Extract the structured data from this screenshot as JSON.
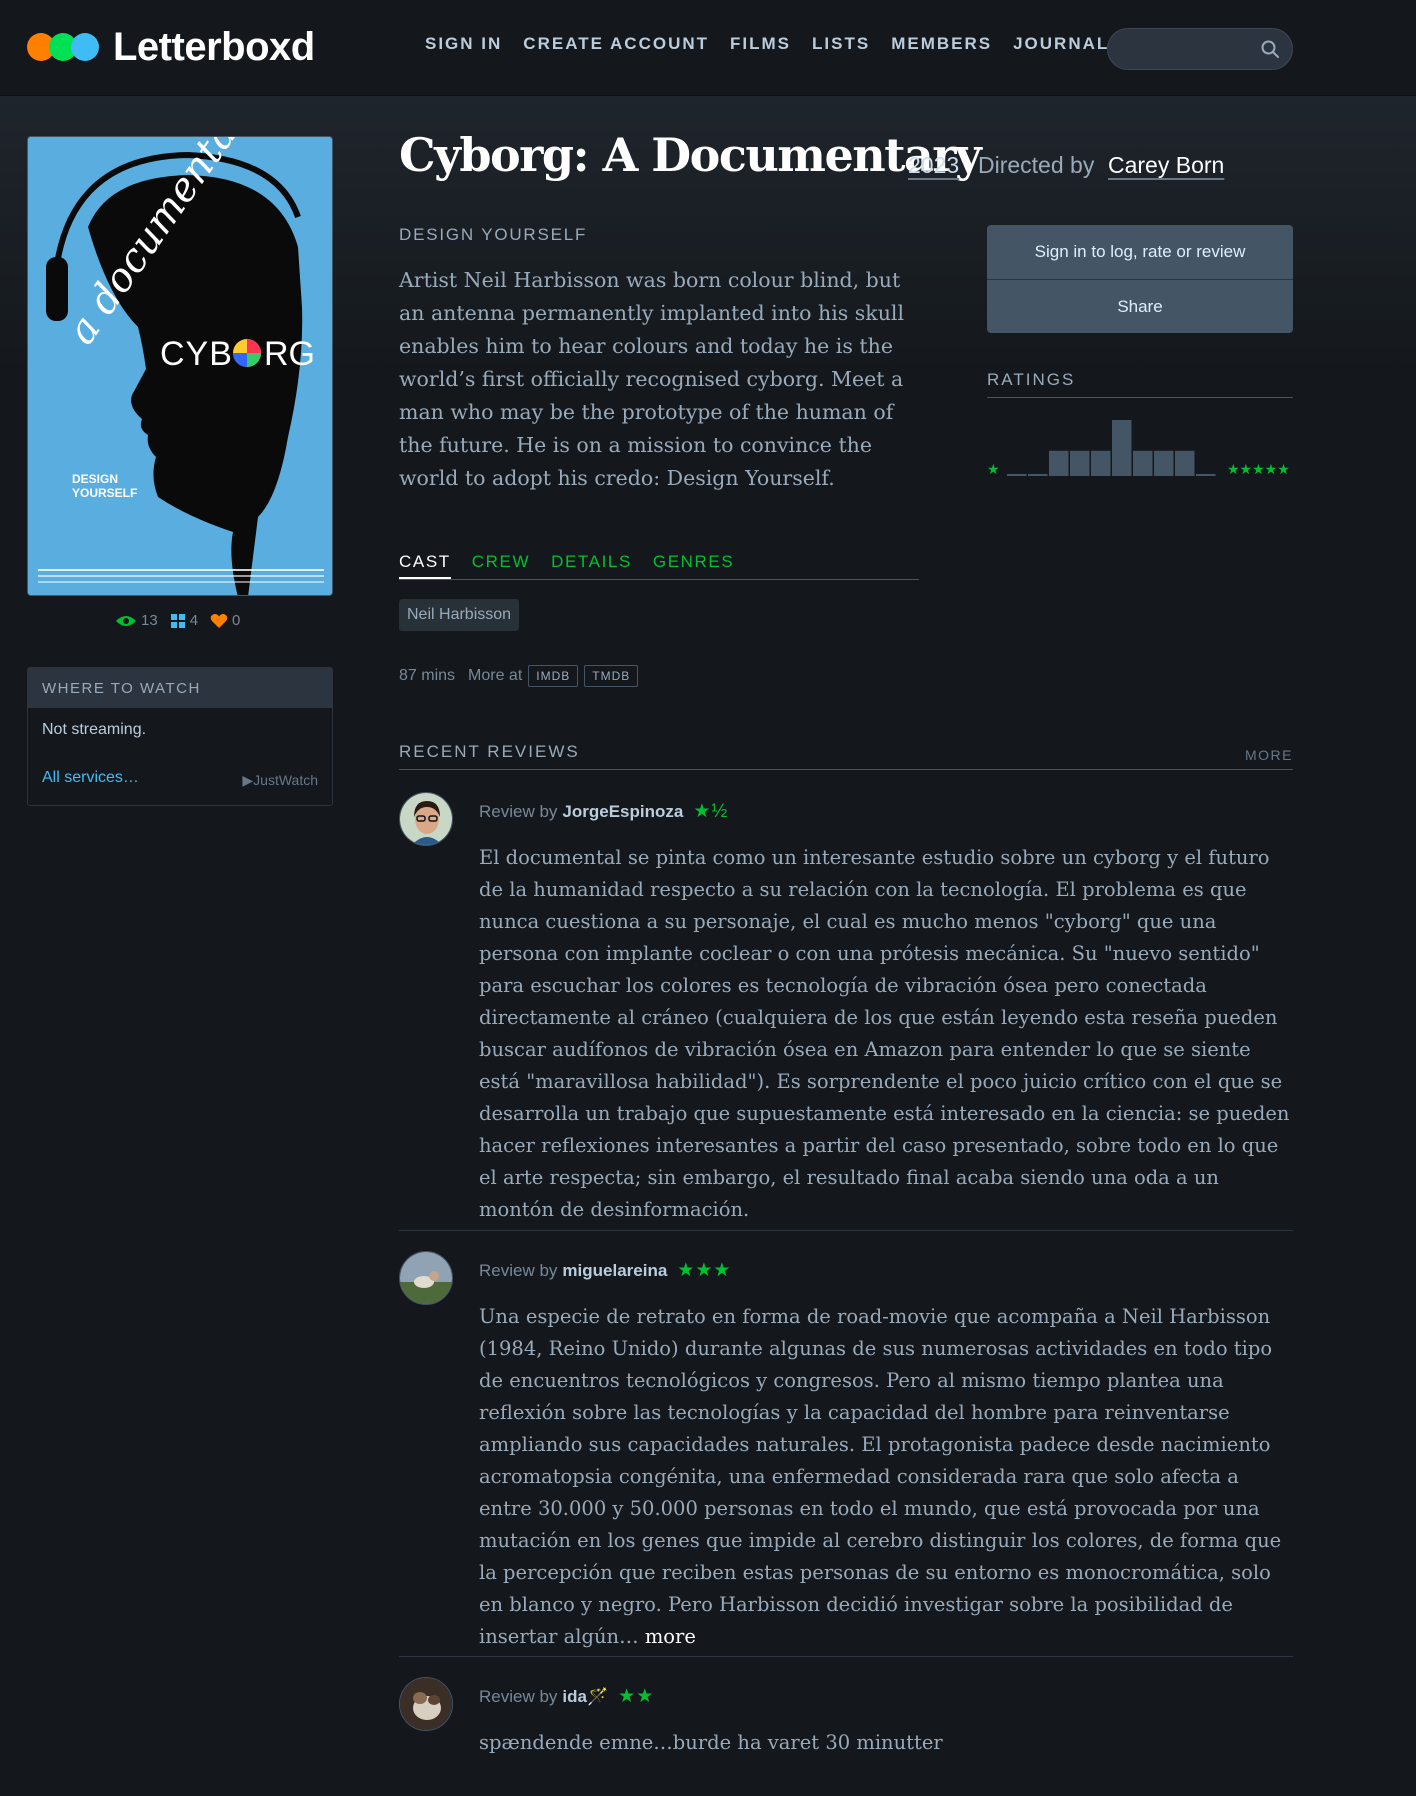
{
  "header": {
    "logo_text": "Letterboxd",
    "nav": [
      "SIGN IN",
      "CREATE ACCOUNT",
      "FILMS",
      "LISTS",
      "MEMBERS",
      "JOURNAL"
    ],
    "search_placeholder": ""
  },
  "film": {
    "title": "Cyborg: A Documentary",
    "year": "2023",
    "directed_by_label": "Directed by",
    "director": "Carey Born",
    "tagline": "DESIGN YOURSELF",
    "synopsis": "Artist Neil Harbisson was born colour blind, but an antenna permanently implanted into his skull enables him to hear colours and today he is the world’s first officially recognised cyborg. Meet a man who may be the prototype of the human of the future. He is on a mission to convince the world to adopt his credo: Design Yourself.",
    "stats": {
      "watched": "13",
      "lists": "4",
      "likes": "0"
    },
    "runtime": "87 mins",
    "more_at_label": "More at",
    "external_links": [
      "IMDB",
      "TMDB"
    ]
  },
  "poster": {
    "title_script": "a documentary",
    "title_main": "CYB",
    "title_end": "RG",
    "tagline_line1": "DESIGN",
    "tagline_line2": "YOURSELF"
  },
  "where_to_watch": {
    "heading": "WHERE TO WATCH",
    "status": "Not streaming.",
    "all_services": "All services…",
    "provider": "JustWatch"
  },
  "actions": {
    "log_label": "Sign in to log, rate or review",
    "share_label": "Share"
  },
  "ratings": {
    "heading": "RATINGS",
    "histogram": [
      0.03,
      0.03,
      0.45,
      0.45,
      0.45,
      1.0,
      0.45,
      0.45,
      0.45,
      0.03
    ]
  },
  "tabs": [
    "CAST",
    "CREW",
    "DETAILS",
    "GENRES"
  ],
  "active_tab": "CAST",
  "cast": [
    "Neil Harbisson"
  ],
  "reviews": {
    "heading": "RECENT REVIEWS",
    "more_label": "MORE",
    "review_by_label": "Review by",
    "items": [
      {
        "author": "JorgeEspinoza",
        "rating": "★½",
        "text": "El documental se pinta como un interesante estudio sobre un cyborg y el futuro de la humanidad respecto a su relación con la tecnología. El problema es que nunca cuestiona a su personaje, el cual es mucho menos \"cyborg\" que una persona con implante coclear o con una prótesis mecánica. Su \"nuevo sentido\" para escuchar los colores es tecnología de vibración ósea pero conectada directamente al cráneo (cualquiera de los que están leyendo esta reseña pueden buscar audífonos de vibración ósea en Amazon para entender lo que se siente está \"maravillosa habilidad\"). Es sorprendente el poco juicio crítico con el que se desarrolla un trabajo que supuestamente está interesado en la ciencia: se pueden hacer reflexiones interesantes a partir del caso presentado, sobre todo en lo que el arte respecta; sin embargo, el resultado final acaba siendo una oda a un montón de desinformación."
      },
      {
        "author": "miguelareina",
        "rating": "★★★",
        "text": "Una especie de retrato en forma de road-movie que acompaña a Neil Harbisson (1984, Reino Unido) durante algunas de sus numerosas actividades en todo tipo de encuentros tecnológicos y congresos. Pero al mismo tiempo plantea una reflexión sobre las tecnologías y la capacidad del hombre para reinventarse ampliando sus capacidades naturales. El protagonista padece desde nacimiento acromatopsia congénita, una enfermedad considerada rara que solo afecta a entre 30.000 y 50.000 personas en todo el mundo, que está provocada por una mutación en los genes que impide al cerebro distinguir los colores, de forma que la percepción que reciben estas personas de su entorno es monocromática, solo en blanco y negro. Pero Harbisson decidió investigar sobre la posibilidad de insertar algún…",
        "more_label": "more"
      },
      {
        "author": "ida🪄",
        "rating": "★★",
        "text": "spændende emne…burde ha varet 30 minutter"
      }
    ]
  },
  "colors": {
    "background": "#14181c",
    "accent_green": "#00c030",
    "link_blue": "#40bcf4",
    "logo_orange": "#ff8000",
    "logo_green": "#00e054",
    "logo_blue": "#40bcf4"
  }
}
